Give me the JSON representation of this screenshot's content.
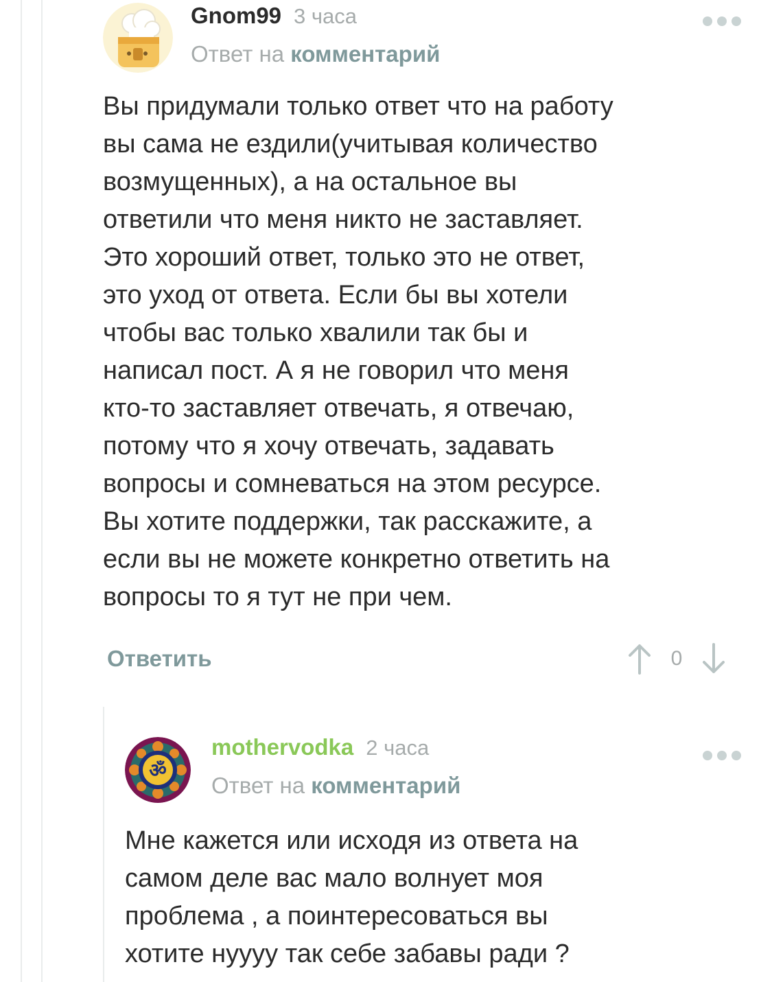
{
  "comments": [
    {
      "author": "Gnom99",
      "time": "3 часа",
      "reply_prefix": "Ответ на",
      "reply_link": "комментарий",
      "avatar_icon": "chef-hat-avatar-icon",
      "text": "Вы придумали только ответ что на работу\nвы сама не ездили(учитывая количество\nвозмущенных), а на остальное вы\nответили что меня никто не заставляет.\nЭто хороший ответ, только это не ответ,\nэто уход от ответа. Если бы вы хотели\nчтобы вас только хвалили так бы и\nнаписал пост. А я не говорил что меня\nкто-то заставляет отвечать, я отвечаю,\nпотому что я хочу отвечать, задавать\nвопросы и сомневаться на этом ресурсе.\nВы хотите поддержки, так расскажите, а\nесли вы не можете конкретно ответить на\nвопросы то я тут не при чем.",
      "reply_button": "Ответить",
      "rating": "0"
    },
    {
      "author": "mothervodka",
      "time": "2 часа",
      "reply_prefix": "Ответ на",
      "reply_link": "комментарий",
      "avatar_icon": "om-mandala-avatar-icon",
      "text": "Мне кажется или исходя из ответа на\nсамом деле вас мало волнует моя\nпроблема , а поинтересоваться вы\nхотите нуууу так себе забавы ради ?"
    }
  ],
  "colors": {
    "author_green": "#8ac858",
    "link": "#7f999b",
    "muted": "#a6abab",
    "thread_line": "#e9ecec"
  }
}
